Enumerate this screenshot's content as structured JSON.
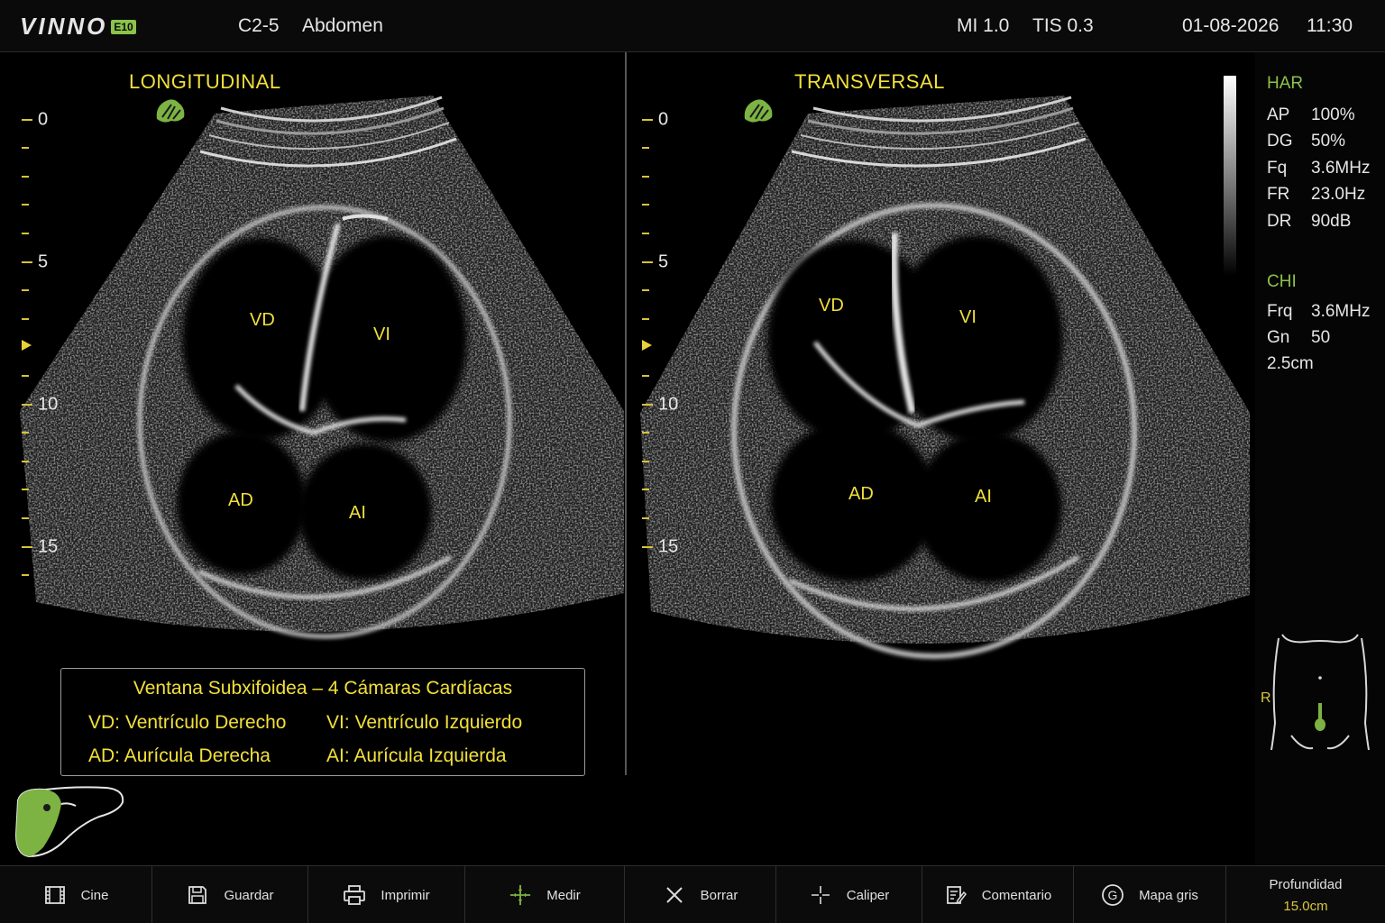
{
  "header": {
    "brand": "VINNO",
    "brand_badge": "E10",
    "probe": "C2-5",
    "preset": "Abdomen",
    "mi": "MI 1.0",
    "tis": "TIS 0.3",
    "date": "01-08-2026",
    "time": "11:30"
  },
  "left_view": {
    "title": "LONGITUDINAL",
    "labels": {
      "vd": "VD",
      "vi": "VI",
      "ad": "AD",
      "ai": "AI"
    },
    "depth_ticks": [
      "0",
      "5",
      "10",
      "15"
    ]
  },
  "right_view": {
    "title": "TRANSVERSAL",
    "labels": {
      "vd": "VD",
      "vi": "VI",
      "ad": "AD",
      "ai": "AI"
    },
    "depth_ticks": [
      "0",
      "5",
      "10",
      "15"
    ]
  },
  "caption": {
    "title": "Ventana Subxifoidea – 4 Cámaras Cardíacas",
    "vd": "VD: Ventrículo Derecho",
    "vi": "VI: Ventrículo Izquierdo",
    "ad": "AD: Aurícula Derecha",
    "ai": "AI: Aurícula Izquierda"
  },
  "params": {
    "har_title": "HAR",
    "har": [
      {
        "k": "AP",
        "v": "100%"
      },
      {
        "k": "DG",
        "v": "50%"
      },
      {
        "k": "Fq",
        "v": "3.6MHz"
      },
      {
        "k": "FR",
        "v": "23.0Hz"
      },
      {
        "k": "DR",
        "v": "90dB"
      }
    ],
    "chi_title": "CHI",
    "chi": [
      {
        "k": "Frq",
        "v": "3.6MHz"
      },
      {
        "k": "Gn",
        "v": "50"
      }
    ],
    "extra": "2.5cm",
    "side_marker": "R"
  },
  "toolbar": {
    "cine": "Cine",
    "save": "Guardar",
    "print": "Imprimir",
    "measure": "Medir",
    "delete": "Borrar",
    "caliper": "Caliper",
    "comment": "Comentario",
    "graymap": "Mapa gris",
    "depth_title": "Profundidad",
    "depth_value": "15.0cm"
  },
  "colors": {
    "annotation": "#f2e03a",
    "accent_green": "#8bc34a",
    "background": "#000000"
  },
  "icons": [
    "film-icon",
    "floppy-icon",
    "printer-icon",
    "plus-icon",
    "x-icon",
    "crosshair-icon",
    "comment-icon",
    "g-circle-icon",
    "liver-icon",
    "body-marker-icon"
  ]
}
